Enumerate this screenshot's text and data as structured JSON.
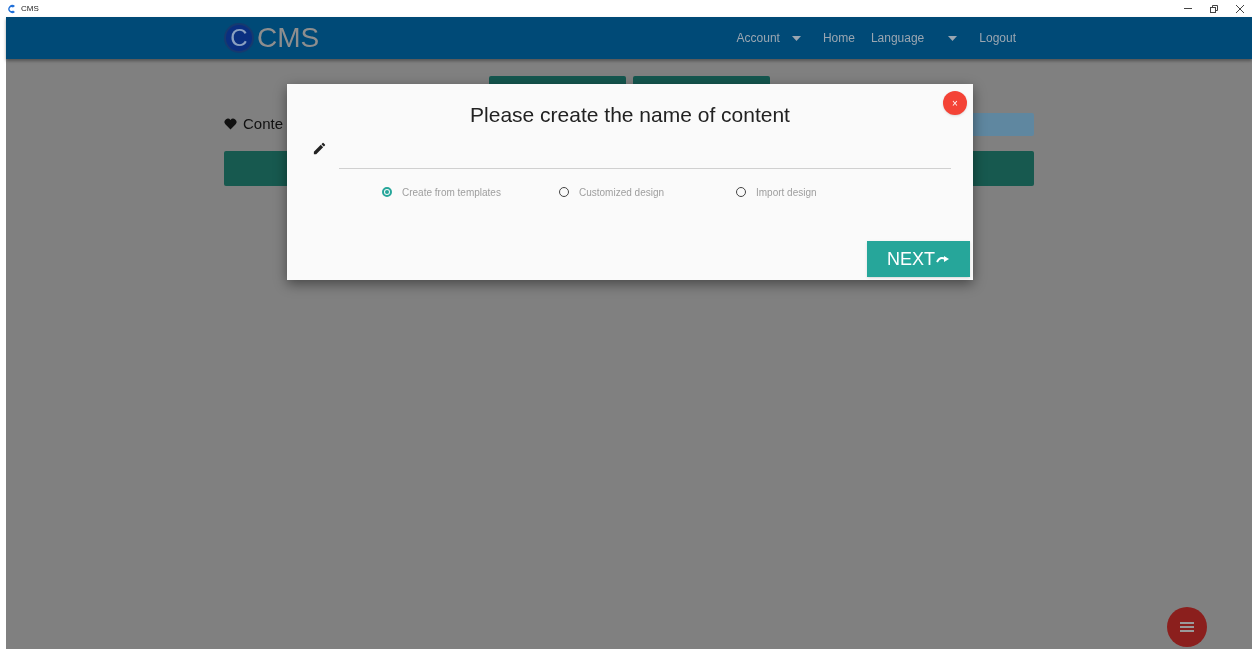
{
  "window": {
    "title": "CMS"
  },
  "header": {
    "logo": {
      "letter": "C",
      "text": "CMS"
    },
    "nav": [
      {
        "label": "Account",
        "dropdown": true
      },
      {
        "label": "Home",
        "dropdown": false
      },
      {
        "label": "Language",
        "dropdown": true
      },
      {
        "label": "Logout",
        "dropdown": false
      }
    ]
  },
  "page": {
    "section_title": "Conte"
  },
  "dialog": {
    "title": "Please create the name of content",
    "close": "×",
    "options": [
      {
        "label": "Create from templates",
        "selected": true
      },
      {
        "label": "Customized design",
        "selected": false
      },
      {
        "label": "Import design",
        "selected": false
      }
    ],
    "next_button": "NEXT"
  }
}
